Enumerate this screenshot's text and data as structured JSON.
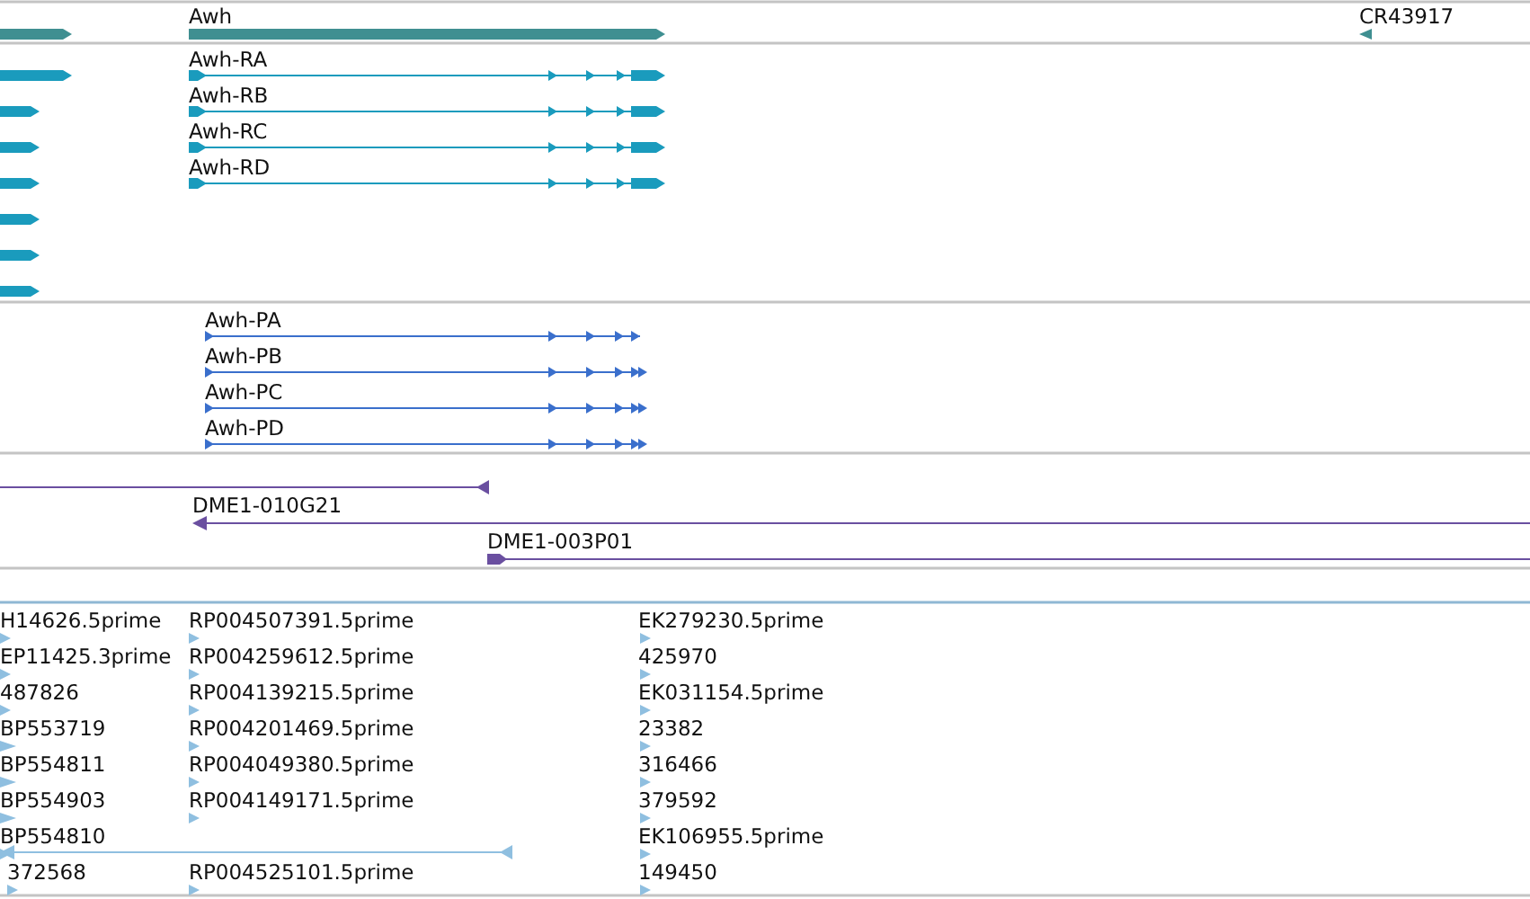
{
  "gene_track": {
    "genes": [
      {
        "name": "Awh"
      },
      {
        "name": "CR43917"
      }
    ]
  },
  "transcript_track": {
    "transcripts": [
      "Awh-RA",
      "Awh-RB",
      "Awh-RC",
      "Awh-RD"
    ]
  },
  "protein_track": {
    "proteins": [
      "Awh-PA",
      "Awh-PB",
      "Awh-PC",
      "Awh-PD"
    ]
  },
  "clone_track": {
    "clones": [
      "DME1-010G21",
      "DME1-003P01"
    ]
  },
  "est_track": {
    "rows": [
      {
        "column_1": "H14626.5prime",
        "column_2": "RP004507391.5prime",
        "column_3": "EK279230.5prime"
      },
      {
        "column_1": "EP11425.3prime",
        "column_2": "RP004259612.5prime",
        "column_3": "425970"
      },
      {
        "column_1": "487826",
        "column_2": "RP004139215.5prime",
        "column_3": "EK031154.5prime"
      },
      {
        "column_1": "BP553719",
        "column_2": "RP004201469.5prime",
        "column_3": "23382"
      },
      {
        "column_1": "BP554811",
        "column_2": "RP004049380.5prime",
        "column_3": "316466"
      },
      {
        "column_1": "BP554903",
        "column_2": "RP004149171.5prime",
        "column_3": "379592"
      },
      {
        "column_1": "BP554810",
        "column_3": "EK106955.5prime"
      },
      {
        "column_1": "372568",
        "column_2": "RP004525101.5prime",
        "column_3": "149450"
      }
    ]
  }
}
